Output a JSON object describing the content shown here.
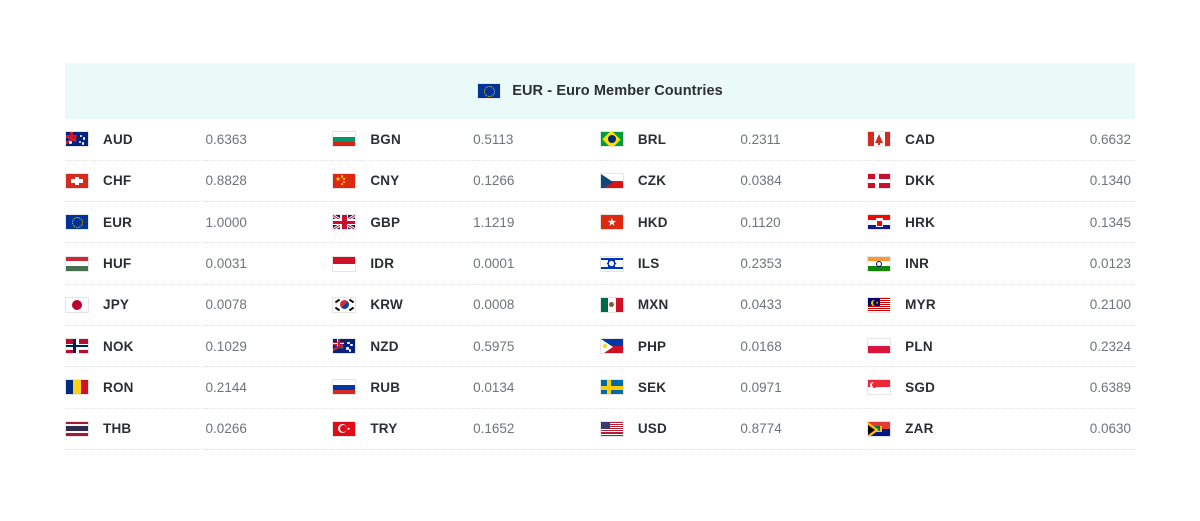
{
  "header": {
    "flag_icon": "eu-flag-icon",
    "title": "EUR - Euro Member Countries"
  },
  "columns_per_row": 4,
  "rates": [
    [
      {
        "code": "AUD",
        "value": "0.6363",
        "flag": "au-flag-icon"
      },
      {
        "code": "BGN",
        "value": "0.5113",
        "flag": "bg-flag-icon"
      },
      {
        "code": "BRL",
        "value": "0.2311",
        "flag": "br-flag-icon"
      },
      {
        "code": "CAD",
        "value": "0.6632",
        "flag": "ca-flag-icon"
      }
    ],
    [
      {
        "code": "CHF",
        "value": "0.8828",
        "flag": "ch-flag-icon"
      },
      {
        "code": "CNY",
        "value": "0.1266",
        "flag": "cn-flag-icon"
      },
      {
        "code": "CZK",
        "value": "0.0384",
        "flag": "cz-flag-icon"
      },
      {
        "code": "DKK",
        "value": "0.1340",
        "flag": "dk-flag-icon"
      }
    ],
    [
      {
        "code": "EUR",
        "value": "1.0000",
        "flag": "eu-flag-icon"
      },
      {
        "code": "GBP",
        "value": "1.1219",
        "flag": "gb-flag-icon"
      },
      {
        "code": "HKD",
        "value": "0.1120",
        "flag": "hk-flag-icon"
      },
      {
        "code": "HRK",
        "value": "0.1345",
        "flag": "hr-flag-icon"
      }
    ],
    [
      {
        "code": "HUF",
        "value": "0.0031",
        "flag": "hu-flag-icon"
      },
      {
        "code": "IDR",
        "value": "0.0001",
        "flag": "id-flag-icon"
      },
      {
        "code": "ILS",
        "value": "0.2353",
        "flag": "il-flag-icon"
      },
      {
        "code": "INR",
        "value": "0.0123",
        "flag": "in-flag-icon"
      }
    ],
    [
      {
        "code": "JPY",
        "value": "0.0078",
        "flag": "jp-flag-icon"
      },
      {
        "code": "KRW",
        "value": "0.0008",
        "flag": "kr-flag-icon"
      },
      {
        "code": "MXN",
        "value": "0.0433",
        "flag": "mx-flag-icon"
      },
      {
        "code": "MYR",
        "value": "0.2100",
        "flag": "my-flag-icon"
      }
    ],
    [
      {
        "code": "NOK",
        "value": "0.1029",
        "flag": "no-flag-icon"
      },
      {
        "code": "NZD",
        "value": "0.5975",
        "flag": "nz-flag-icon"
      },
      {
        "code": "PHP",
        "value": "0.0168",
        "flag": "ph-flag-icon"
      },
      {
        "code": "PLN",
        "value": "0.2324",
        "flag": "pl-flag-icon"
      }
    ],
    [
      {
        "code": "RON",
        "value": "0.2144",
        "flag": "ro-flag-icon"
      },
      {
        "code": "RUB",
        "value": "0.0134",
        "flag": "ru-flag-icon"
      },
      {
        "code": "SEK",
        "value": "0.0971",
        "flag": "se-flag-icon"
      },
      {
        "code": "SGD",
        "value": "0.6389",
        "flag": "sg-flag-icon"
      }
    ],
    [
      {
        "code": "THB",
        "value": "0.0266",
        "flag": "th-flag-icon"
      },
      {
        "code": "TRY",
        "value": "0.1652",
        "flag": "tr-flag-icon"
      },
      {
        "code": "USD",
        "value": "0.8774",
        "flag": "us-flag-icon"
      },
      {
        "code": "ZAR",
        "value": "0.0630",
        "flag": "za-flag-icon"
      }
    ]
  ],
  "colors": {
    "header_background": "#eafaf8",
    "code_text": "#2b2f33",
    "value_text": "#6e7478",
    "row_divider": "#dfe3e6"
  }
}
